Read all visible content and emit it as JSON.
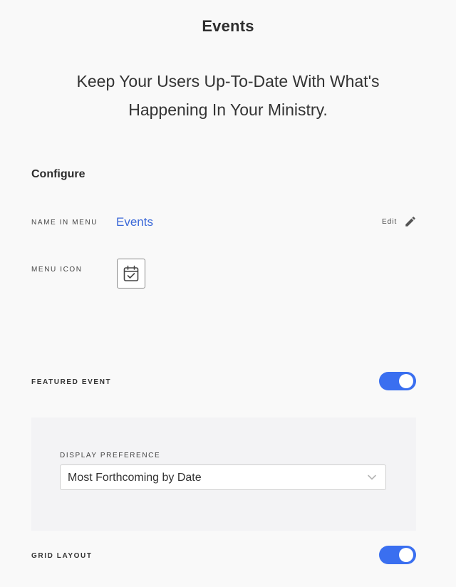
{
  "header": {
    "title": "Events",
    "subtitle": "Keep Your Users Up-To-Date With What's Happening In Your Ministry."
  },
  "configure": {
    "section_title": "Configure",
    "name_in_menu": {
      "label": "NAME IN MENU",
      "value": "Events",
      "edit_label": "Edit"
    },
    "menu_icon": {
      "label": "MENU ICON",
      "icon": "calendar-check-icon"
    }
  },
  "featured_event": {
    "label": "FEATURED EVENT",
    "enabled": true,
    "display_preference": {
      "label": "DISPLAY PREFERENCE",
      "selected": "Most Forthcoming by Date"
    }
  },
  "grid_layout": {
    "label": "GRID LAYOUT",
    "enabled": true
  },
  "colors": {
    "accent": "#3a6ff0",
    "link": "#3a68d8",
    "background": "#f9f9f9",
    "panel": "#f3f3f5"
  }
}
